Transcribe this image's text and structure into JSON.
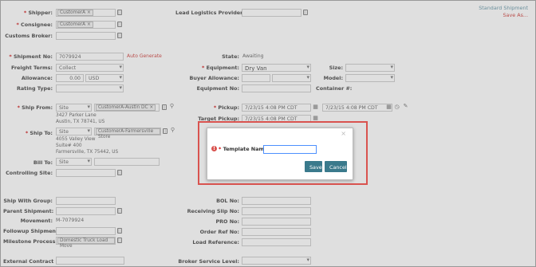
{
  "corner": {
    "title": "Standard Shipment",
    "save_as": "Save As..."
  },
  "colors": {
    "accent": "#3a7a8c",
    "link_red": "#c9302c",
    "highlight_border": "#d9534f"
  },
  "section1": {
    "shipper": {
      "label": "Shipper:",
      "tag": "CustomerA"
    },
    "consignee": {
      "label": "Consignee:",
      "tag": "CustomerA"
    },
    "customs_broker": {
      "label": "Customs Broker:"
    },
    "llp": {
      "label": "Lead Logistics Provider:"
    }
  },
  "section2": {
    "shipment_no": {
      "label": "Shipment No:",
      "value": "7079924",
      "auto": "Auto Generate"
    },
    "freight_terms": {
      "label": "Freight Terms:",
      "value": "Collect"
    },
    "allowance": {
      "label": "Allowance:",
      "value": "0.00",
      "currency": "USD"
    },
    "rating_type": {
      "label": "Rating Type:"
    },
    "state": {
      "label": "State:",
      "value": "Awaiting"
    },
    "equipment": {
      "label": "Equipment:",
      "value": "Dry Van"
    },
    "buyer_allowance": {
      "label": "Buyer Allowance:"
    },
    "equipment_no": {
      "label": "Equipment No:"
    },
    "size": {
      "label": "Size:"
    },
    "model": {
      "label": "Model:"
    },
    "container": {
      "label": "Container #:"
    }
  },
  "section3": {
    "ship_from": {
      "label": "Ship From:",
      "type": "Site",
      "tag": "CustomerA-Austin DC",
      "addr1": "3427 Parker Lane",
      "addr2": "Austin, TX 78741, US"
    },
    "ship_to": {
      "label": "Ship To:",
      "type": "Site",
      "tag": "CustomerA-Farmersville Store",
      "addr1": "4055 Valley View",
      "addr2": "Suite# 400",
      "addr3": "Farmersville, TX 75442, US"
    },
    "bill_to": {
      "label": "Bill To:",
      "type": "Site"
    },
    "controlling_site": {
      "label": "Controlling Site:"
    },
    "pickup": {
      "label": "Pickup:",
      "date1": "7/23/15 4:08 PM CDT",
      "date2": "7/23/15 4:08 PM CDT"
    },
    "target_pickup": {
      "label": "Target Pickup:",
      "date1": "7/23/15 4:08 PM CDT"
    }
  },
  "section4": {
    "ship_with_group": {
      "label": "Ship With Group:"
    },
    "parent_shipment": {
      "label": "Parent Shipment:"
    },
    "movement": {
      "label": "Movement:",
      "value": "M-7079924"
    },
    "followup_shipment": {
      "label": "Followup Shipment:"
    },
    "milestone_process": {
      "label": "Milestone Process:",
      "tag": "Domestic Truck Load Move"
    },
    "external_contract": {
      "label": "External Contract No:"
    },
    "bol_no": {
      "label": "BOL No:"
    },
    "receiving_slip": {
      "label": "Receiving Slip No:"
    },
    "pro_no": {
      "label": "PRO No:"
    },
    "order_ref": {
      "label": "Order Ref No:"
    },
    "load_reference": {
      "label": "Load Reference:"
    },
    "broker_service_level": {
      "label": "Broker Service Level:"
    }
  },
  "modal": {
    "required_mark": "*",
    "template_label": "Template Name:",
    "template_value": "",
    "close_glyph": "×",
    "save_label": "Save",
    "cancel_label": "Cancel"
  },
  "icons": {
    "lookup": "address-book-icon",
    "search": "search-icon",
    "calendar": "calendar-icon",
    "clock": "clock-icon",
    "note": "notepad-icon",
    "remove": "tag-remove-icon",
    "error": "error-icon"
  }
}
